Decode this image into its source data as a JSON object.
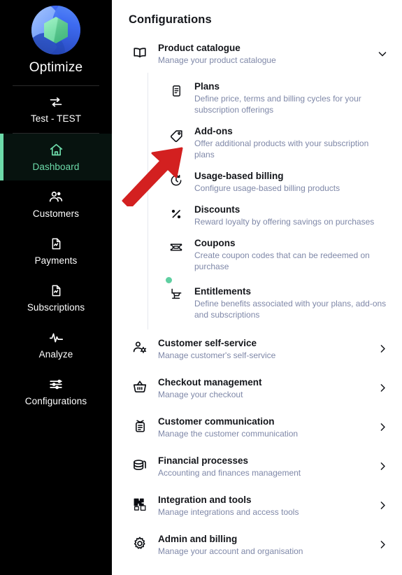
{
  "sidebar": {
    "logo_icon": "optimize-logo-icon",
    "brand_name": "Optimize",
    "tenant": {
      "icon": "swap-arrows-icon",
      "label": "Test - TEST"
    },
    "nav_items": [
      {
        "label": "Dashboard",
        "icon": "home-icon",
        "active": true
      },
      {
        "label": "Customers",
        "icon": "customers-icon",
        "active": false
      },
      {
        "label": "Payments",
        "icon": "document-icon",
        "active": false
      },
      {
        "label": "Subscriptions",
        "icon": "document-icon",
        "active": false
      },
      {
        "label": "Analyze",
        "icon": "pulse-icon",
        "active": false
      },
      {
        "label": "Configurations",
        "icon": "sliders-icon",
        "active": false
      }
    ]
  },
  "main": {
    "page_title": "Configurations",
    "expanded_group": {
      "title": "Product catalogue",
      "subtitle": "Manage your product catalogue",
      "icon": "book-open-icon",
      "chevron": "chevron-down-icon",
      "items": [
        {
          "title": "Plans",
          "subtitle": "Define price, terms and billing cycles for your subscription offerings",
          "icon": "list-document-icon",
          "dot": false
        },
        {
          "title": "Add-ons",
          "subtitle": "Offer additional products with your subscription plans",
          "icon": "tag-icon",
          "dot": false
        },
        {
          "title": "Usage-based billing",
          "subtitle": "Configure usage-based billing products",
          "icon": "timer-icon",
          "dot": true
        },
        {
          "title": "Discounts",
          "subtitle": "Reward loyalty by offering savings on purchases",
          "icon": "percent-icon",
          "dot": false
        },
        {
          "title": "Coupons",
          "subtitle": "Create coupon codes that can be redeemed on purchase",
          "icon": "ticket-icon",
          "dot": false
        },
        {
          "title": "Entitlements",
          "subtitle": "Define benefits associated with your plans, add-ons and subscriptions",
          "icon": "cart-icon",
          "dot": true
        }
      ]
    },
    "groups": [
      {
        "title": "Customer self-service",
        "subtitle": "Manage customer's self-service",
        "icon": "user-gear-icon",
        "chevron": "chevron-right-icon"
      },
      {
        "title": "Checkout management",
        "subtitle": "Manage your checkout",
        "icon": "basket-icon",
        "chevron": "chevron-right-icon"
      },
      {
        "title": "Customer communication",
        "subtitle": "Manage the customer communication",
        "icon": "radio-message-icon",
        "chevron": "chevron-right-icon"
      },
      {
        "title": "Financial processes",
        "subtitle": "Accounting and finances management",
        "icon": "coins-icon",
        "chevron": "chevron-right-icon"
      },
      {
        "title": "Integration and tools",
        "subtitle": "Manage integrations and access tools",
        "icon": "puzzle-icon",
        "chevron": "chevron-right-icon"
      },
      {
        "title": "Admin and billing",
        "subtitle": "Manage your account and organisation",
        "icon": "gear-icon",
        "chevron": "chevron-right-icon"
      }
    ]
  },
  "annotation": {
    "arrow_icon": "red-pointer-arrow-icon",
    "arrow_color": "#d32020",
    "points_at": "Add-ons"
  },
  "colors": {
    "sidebar_bg": "#000000",
    "accent_green": "#6ddbaa",
    "dot_green": "#5fcfa1",
    "title_text": "#14161b",
    "subtitle_text": "#7f88a8",
    "main_bg": "#ffffff"
  }
}
